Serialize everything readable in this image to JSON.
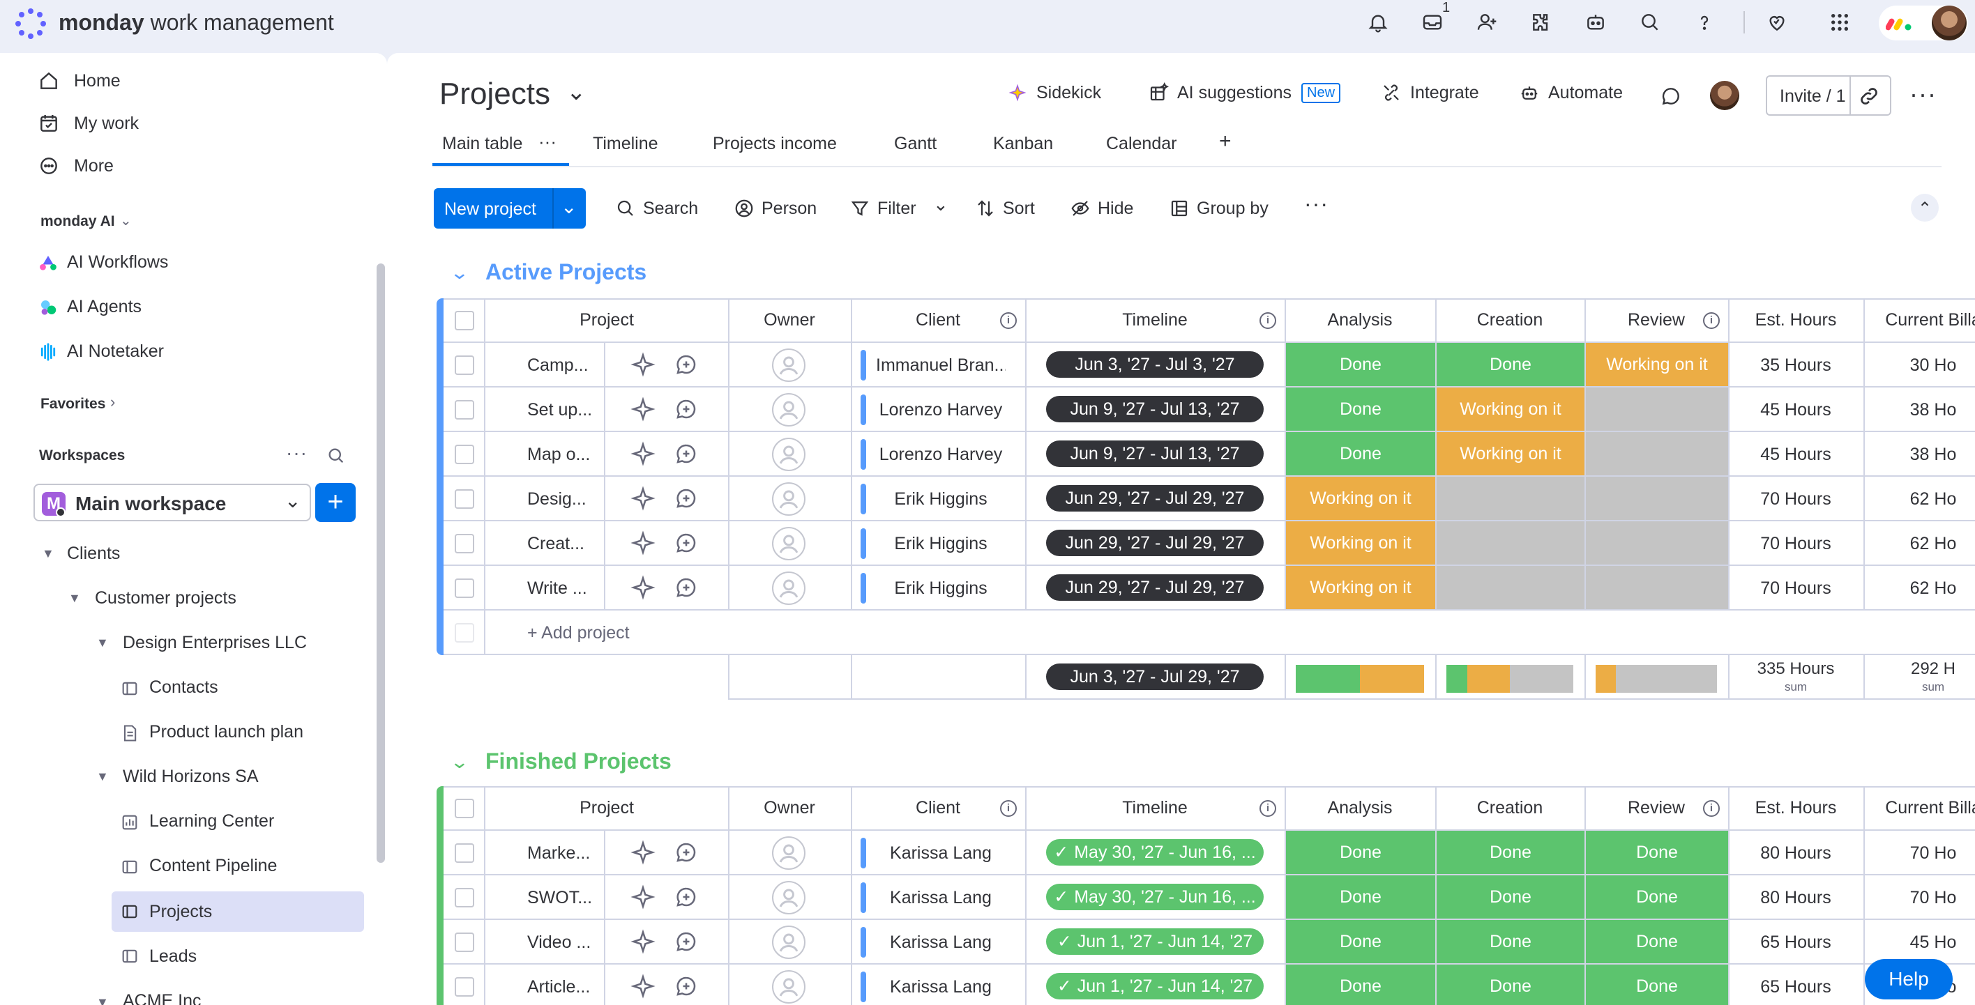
{
  "topbar": {
    "brand_bold": "monday",
    "brand_rest": "work management",
    "inbox_badge": "1"
  },
  "sidebar": {
    "nav": [
      {
        "label": "Home",
        "icon": "home-icon"
      },
      {
        "label": "My work",
        "icon": "calendar-check-icon"
      },
      {
        "label": "More",
        "icon": "more-circle-icon"
      }
    ],
    "ai_section": "monday AI",
    "ai_items": [
      "AI Workflows",
      "AI Agents",
      "AI Notetaker"
    ],
    "favorites": "Favorites",
    "workspaces": "Workspaces",
    "workspace_name": "Main workspace",
    "workspace_letter": "M",
    "tree": [
      {
        "label": "Clients"
      },
      {
        "label": "Customer projects"
      },
      {
        "label": "Design Enterprises LLC"
      },
      {
        "label": "Contacts"
      },
      {
        "label": "Product launch plan"
      },
      {
        "label": "Wild Horizons SA"
      },
      {
        "label": "Learning Center"
      },
      {
        "label": "Content Pipeline"
      },
      {
        "label": "Projects"
      },
      {
        "label": "Leads"
      },
      {
        "label": "ACME Inc"
      }
    ]
  },
  "header": {
    "title": "Projects",
    "sidekick": "Sidekick",
    "ai_suggestions": "AI suggestions",
    "new_tag": "New",
    "integrate": "Integrate",
    "automate": "Automate",
    "invite": "Invite / 1"
  },
  "tabs": [
    "Main table",
    "Timeline",
    "Projects income",
    "Gantt",
    "Kanban",
    "Calendar"
  ],
  "toolbar": {
    "new_project": "New project",
    "search": "Search",
    "person": "Person",
    "filter": "Filter",
    "sort": "Sort",
    "hide": "Hide",
    "group_by": "Group by"
  },
  "columns": [
    "Project",
    "Owner",
    "Client",
    "Timeline",
    "Analysis",
    "Creation",
    "Review",
    "Est. Hours",
    "Current Billa"
  ],
  "colors": {
    "done": "#5cc46e",
    "working": "#ecad45",
    "empty": "#c4c4c4",
    "active": "#579bfc",
    "finished": "#5cc46e"
  },
  "active_group": {
    "title": "Active Projects",
    "add_label": "+ Add project",
    "rows": [
      {
        "project": "Camp...",
        "client": "Immanuel Bran...",
        "timeline": "Jun 3, '27 - Jul 3, '27",
        "analysis": "Done",
        "creation": "Done",
        "review": "Working on it",
        "hours": "35 Hours",
        "billable": "30 Ho"
      },
      {
        "project": "Set up...",
        "client": "Lorenzo Harvey",
        "timeline": "Jun 9, '27 - Jul 13, '27",
        "analysis": "Done",
        "creation": "Working on it",
        "review": "",
        "hours": "45 Hours",
        "billable": "38 Ho"
      },
      {
        "project": "Map o...",
        "client": "Lorenzo Harvey",
        "timeline": "Jun 9, '27 - Jul 13, '27",
        "analysis": "Done",
        "creation": "Working on it",
        "review": "",
        "hours": "45 Hours",
        "billable": "38 Ho"
      },
      {
        "project": "Desig...",
        "client": "Erik Higgins",
        "timeline": "Jun 29, '27 - Jul 29, '27",
        "analysis": "Working on it",
        "creation": "",
        "review": "",
        "hours": "70 Hours",
        "billable": "62 Ho"
      },
      {
        "project": "Creat...",
        "client": "Erik Higgins",
        "timeline": "Jun 29, '27 - Jul 29, '27",
        "analysis": "Working on it",
        "creation": "",
        "review": "",
        "hours": "70 Hours",
        "billable": "62 Ho"
      },
      {
        "project": "Write ...",
        "client": "Erik Higgins",
        "timeline": "Jun 29, '27 - Jul 29, '27",
        "analysis": "Working on it",
        "creation": "",
        "review": "",
        "hours": "70 Hours",
        "billable": "62 Ho"
      }
    ],
    "summary": {
      "timeline": "Jun 3, '27 - Jul 29, '27",
      "hours": "335 Hours",
      "billable": "292 H",
      "sum_label": "sum",
      "analysis_bar": [
        {
          "status": "done",
          "fraction": 0.5
        },
        {
          "status": "working",
          "fraction": 0.5
        }
      ],
      "creation_bar": [
        {
          "status": "done",
          "fraction": 0.167
        },
        {
          "status": "working",
          "fraction": 0.333
        },
        {
          "status": "empty",
          "fraction": 0.5
        }
      ],
      "review_bar": [
        {
          "status": "working",
          "fraction": 0.167
        },
        {
          "status": "empty",
          "fraction": 0.833
        }
      ]
    }
  },
  "finished_group": {
    "title": "Finished Projects",
    "rows": [
      {
        "project": "Marke...",
        "client": "Karissa Lang",
        "timeline": "May 30, '27 - Jun 16, ...",
        "analysis": "Done",
        "creation": "Done",
        "review": "Done",
        "hours": "80 Hours",
        "billable": "70 Ho"
      },
      {
        "project": "SWOT...",
        "client": "Karissa Lang",
        "timeline": "May 30, '27 - Jun 16, ...",
        "analysis": "Done",
        "creation": "Done",
        "review": "Done",
        "hours": "80 Hours",
        "billable": "70 Ho"
      },
      {
        "project": "Video ...",
        "client": "Karissa Lang",
        "timeline": "Jun 1, '27 - Jun 14, '27",
        "analysis": "Done",
        "creation": "Done",
        "review": "Done",
        "hours": "65 Hours",
        "billable": "45 Ho"
      },
      {
        "project": "Article...",
        "client": "Karissa Lang",
        "timeline": "Jun 1, '27 - Jun 14, '27",
        "analysis": "Done",
        "creation": "Done",
        "review": "Done",
        "hours": "65 Hours",
        "billable": "45 Ho"
      }
    ]
  },
  "help": "Help"
}
